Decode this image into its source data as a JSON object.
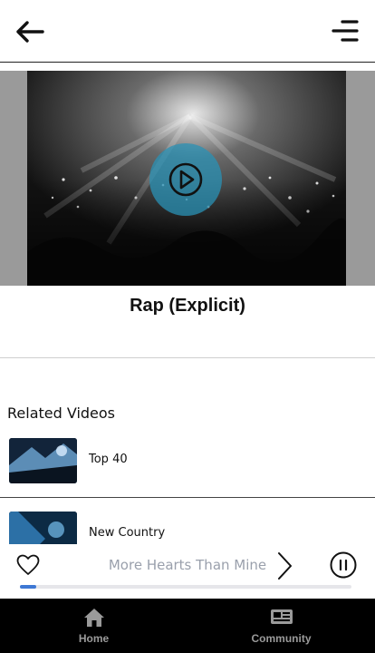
{
  "video": {
    "title": "Rap (Explicit)"
  },
  "related": {
    "heading": "Related Videos",
    "items": [
      {
        "label": "Top 40"
      },
      {
        "label": "New Country"
      }
    ]
  },
  "player": {
    "track": "More Hearts Than Mine",
    "progress_fraction": 0.05
  },
  "nav": {
    "tabs": [
      {
        "label": "Home",
        "icon": "home-icon"
      },
      {
        "label": "Community",
        "icon": "community-icon"
      }
    ]
  },
  "colors": {
    "accent": "#2992b6",
    "progress": "#3e78d4",
    "nav_bg": "#000000"
  }
}
